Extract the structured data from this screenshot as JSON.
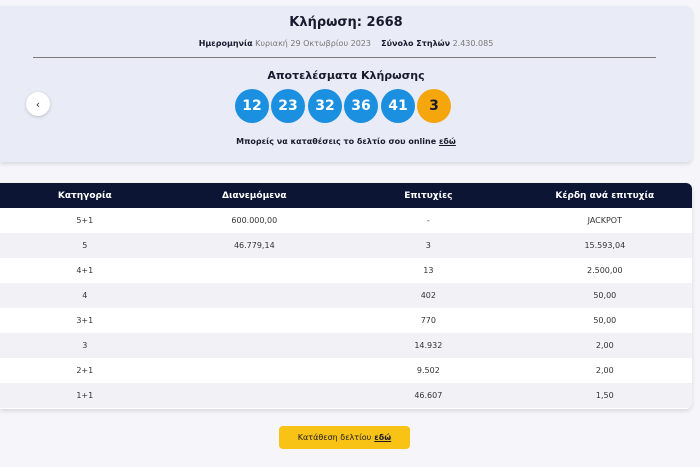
{
  "draw": {
    "title": "Κλήρωση: 2668",
    "date_label": "Ημερομηνία",
    "date_value": "Κυριακή 29 Οκτωβρίου 2023",
    "columns_label": "Σύνολο Στηλών",
    "columns_value": "2.430.085",
    "results_title": "Αποτελέσματα Κλήρωσης",
    "numbers": [
      "12",
      "23",
      "32",
      "36",
      "41"
    ],
    "bonus": "3",
    "bet_text": "Μπορείς να καταθέσεις το δελτίο σου online",
    "bet_link": "εδώ",
    "prev_icon": "‹"
  },
  "table": {
    "headers": [
      "Κατηγορία",
      "Διανεμόμενα",
      "Επιτυχίες",
      "Κέρδη ανά επιτυχία"
    ],
    "rows": [
      [
        "5+1",
        "600.000,00",
        "-",
        "JACKPOT"
      ],
      [
        "5",
        "46.779,14",
        "3",
        "15.593,04"
      ],
      [
        "4+1",
        "",
        "13",
        "2.500,00"
      ],
      [
        "4",
        "",
        "402",
        "50,00"
      ],
      [
        "3+1",
        "",
        "770",
        "50,00"
      ],
      [
        "3",
        "",
        "14.932",
        "2,00"
      ],
      [
        "2+1",
        "",
        "9.502",
        "2,00"
      ],
      [
        "1+1",
        "",
        "46.607",
        "1,50"
      ]
    ]
  },
  "cta": {
    "text": "Κατάθεση δελτίου",
    "link": "εδώ"
  },
  "colors": {
    "ball": "#1b8fe0",
    "bonus_ball": "#f5a60c",
    "table_header": "#0c1534",
    "cta": "#f8c315"
  }
}
